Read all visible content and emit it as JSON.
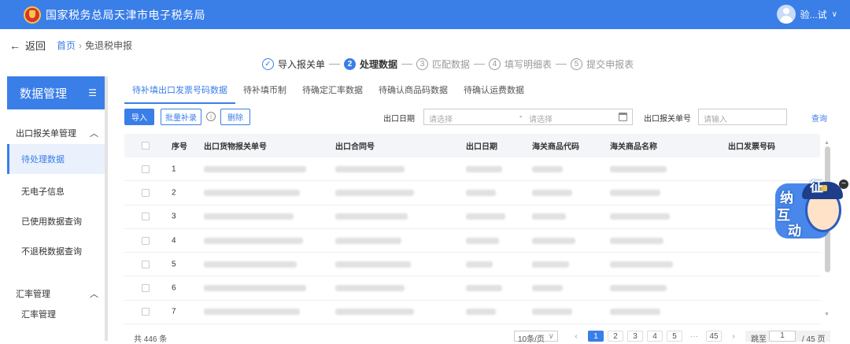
{
  "header": {
    "site_title": "国家税务总局天津市电子税务局",
    "user_name": "验...试",
    "brand_color": "#3a7ee8"
  },
  "breadcrumb": {
    "back_label": "返回",
    "home": "首页",
    "current": "免退税申报"
  },
  "steps": [
    {
      "num": "✓",
      "label": "导入报关单",
      "state": "done"
    },
    {
      "num": "2",
      "label": "处理数据",
      "state": "active"
    },
    {
      "num": "3",
      "label": "匹配数据",
      "state": "todo"
    },
    {
      "num": "4",
      "label": "填写明细表",
      "state": "todo"
    },
    {
      "num": "5",
      "label": "提交申报表",
      "state": "todo"
    }
  ],
  "sidebar": {
    "title": "数据管理",
    "group1": "出口报关单管理",
    "items1": [
      "待处理数据",
      "无电子信息",
      "已使用数据查询",
      "不退税数据查询"
    ],
    "group2": "汇率管理",
    "items2": [
      "汇率管理"
    ]
  },
  "tabs": [
    "待补填出口发票号码数据",
    "待补填币制",
    "待确定汇率数据",
    "待确认商品码数据",
    "待确认运费数据"
  ],
  "toolbar": {
    "import": "导入",
    "batch": "批量补录",
    "delete": "删除",
    "export_date_label": "出口日期",
    "date_start_placeholder": "请选择",
    "date_sep": "-",
    "date_end_placeholder": "请选择",
    "customs_no_label": "出口报关单号",
    "customs_no_placeholder": "请输入",
    "query": "查询"
  },
  "table": {
    "columns": [
      "序号",
      "出口货物报关单号",
      "出口合同号",
      "出口日期",
      "海关商品代码",
      "海关商品名称",
      "出口发票号码"
    ],
    "rows": [
      "1",
      "2",
      "3",
      "4",
      "5",
      "6",
      "7"
    ]
  },
  "pagination": {
    "total": "共 446 条",
    "page_size": "10条/页",
    "prev": "‹",
    "pages": [
      "1",
      "2",
      "3",
      "4",
      "5"
    ],
    "ellipsis": "···",
    "last_page": "45",
    "next": "›",
    "jump_label": "跳至",
    "jump_value": "1",
    "total_pages": "/ 45 页"
  },
  "mascot": {
    "chars": [
      "征",
      "纳",
      "互",
      "动"
    ]
  }
}
